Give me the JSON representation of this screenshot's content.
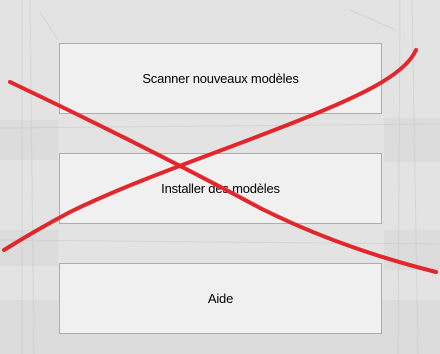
{
  "buttons": {
    "scan_label": "Scanner nouveaux modèles",
    "install_label": "Installer des modèles",
    "help_label": "Aide"
  },
  "overlay": {
    "mark": "red-x-cross",
    "color": "#e3262b"
  }
}
